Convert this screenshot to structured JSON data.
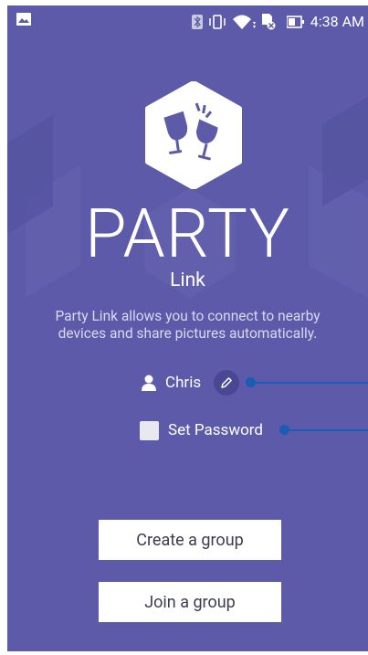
{
  "status_bar": {
    "time": "4:38 AM",
    "icons": [
      "image-icon",
      "bluetooth-icon",
      "vibrate-icon",
      "wifi-icon",
      "no-sim-icon",
      "battery-icon"
    ]
  },
  "app": {
    "title": "PARTY",
    "subtitle": "Link",
    "description": "Party Link allows you to connect to nearby devices and share pictures automatically."
  },
  "user": {
    "name": "Chris"
  },
  "password": {
    "label": "Set Password",
    "checked": false
  },
  "buttons": {
    "create": "Create a group",
    "join": "Join a group"
  },
  "colors": {
    "background": "#5c5aa9",
    "accent_line": "#1b5db5",
    "button_bg": "#ffffff"
  }
}
